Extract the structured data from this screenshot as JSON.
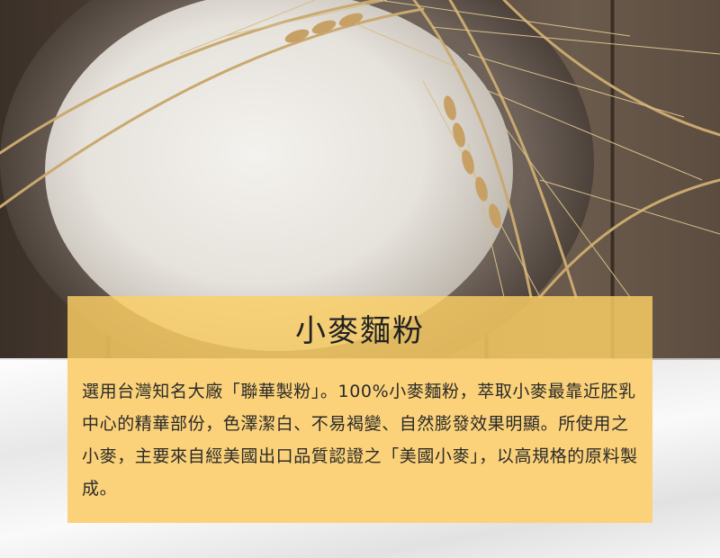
{
  "title": "小麥麵粉",
  "description": "選用台灣知名大廠「聯華製粉」。100%小麥麵粉，萃取小麥最靠近胚乳中心的精華部份，色澤潔白、不易褐變、自然膨發效果明顯。所使用之小麥，主要來自經美國出口品質認證之「美國小麥」，以高規格的原料製成。",
  "colors": {
    "panel": "#fbd279",
    "text": "#2a2a2a"
  }
}
